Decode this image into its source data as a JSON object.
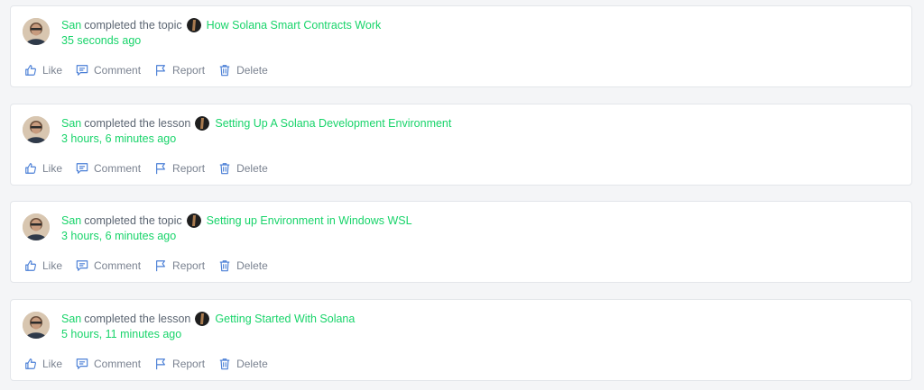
{
  "colors": {
    "accent_green": "#18d46a",
    "icon_blue": "#4a7fd6",
    "muted_text": "#7a8290",
    "card_border": "#e3e6ea",
    "background": "#f4f5f7"
  },
  "feed": {
    "items": [
      {
        "user": "San",
        "action": "completed the topic",
        "target": "How Solana Smart Contracts Work",
        "time": "35 seconds ago",
        "actions": {
          "like": "Like",
          "comment": "Comment",
          "report": "Report",
          "delete": "Delete"
        }
      },
      {
        "user": "San",
        "action": "completed the lesson",
        "target": "Setting Up A Solana Development Environment",
        "time": "3 hours, 6 minutes ago",
        "actions": {
          "like": "Like",
          "comment": "Comment",
          "report": "Report",
          "delete": "Delete"
        }
      },
      {
        "user": "San",
        "action": "completed the topic",
        "target": "Setting up Environment in Windows WSL",
        "time": "3 hours, 6 minutes ago",
        "actions": {
          "like": "Like",
          "comment": "Comment",
          "report": "Report",
          "delete": "Delete"
        }
      },
      {
        "user": "San",
        "action": "completed the lesson",
        "target": "Getting Started With Solana",
        "time": "5 hours, 11 minutes ago",
        "actions": {
          "like": "Like",
          "comment": "Comment",
          "report": "Report",
          "delete": "Delete"
        }
      }
    ]
  },
  "icons": {
    "like": "thumbs-up-icon",
    "comment": "comment-icon",
    "report": "flag-icon",
    "delete": "trash-icon",
    "avatar": "user-avatar",
    "course_thumb": "course-thumbnail"
  }
}
